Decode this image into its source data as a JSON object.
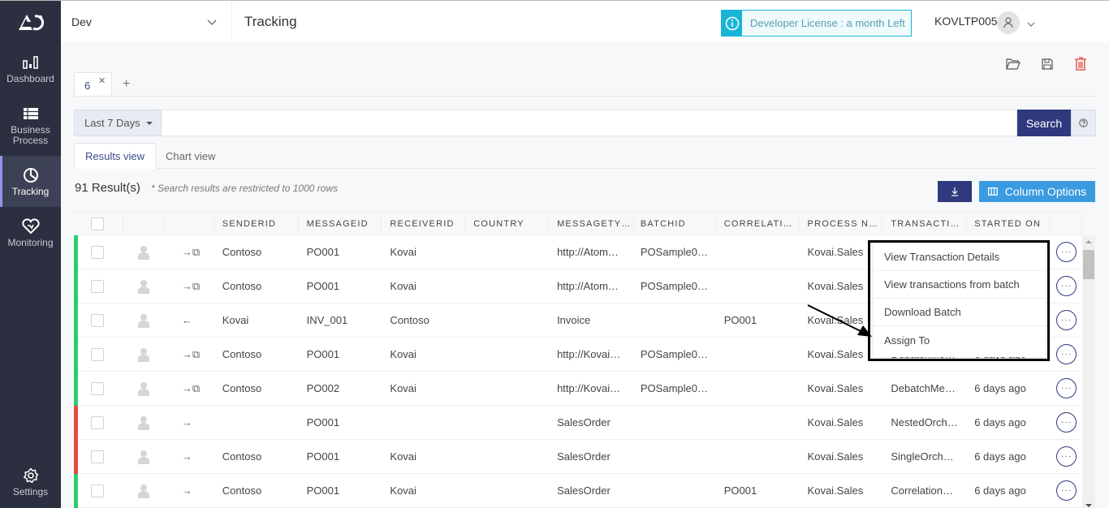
{
  "sidebar": {
    "logo": "logo-icon",
    "items": [
      {
        "label": "Dashboard",
        "icon": "bar-chart-icon"
      },
      {
        "label": "Business Process",
        "icon": "list-icon"
      },
      {
        "label": "Tracking",
        "icon": "pie-chart-icon",
        "active": true
      },
      {
        "label": "Monitoring",
        "icon": "heart-pulse-icon"
      }
    ],
    "settings": {
      "label": "Settings",
      "icon": "gear-icon"
    }
  },
  "header": {
    "environment": "Dev",
    "title": "Tracking",
    "license": "Developer License : a month Left",
    "username": "KOVLTP005"
  },
  "toolbar": {
    "icons": [
      "folder-open-icon",
      "save-icon",
      "trash-icon"
    ]
  },
  "query_tabs": [
    {
      "label": "6"
    }
  ],
  "query_tab_add": "+",
  "search": {
    "range_label": "Last 7 Days",
    "value": "",
    "placeholder": "",
    "button_label": "Search"
  },
  "view_tabs": [
    {
      "label": "Results view",
      "active": true
    },
    {
      "label": "Chart view",
      "active": false
    }
  ],
  "results": {
    "count_label": "91 Result(s)",
    "note": "* Search results are restricted to 1000 rows"
  },
  "actions": {
    "column_options_label": "Column Options"
  },
  "colors": {
    "success": "#2ecc71",
    "error": "#e74c3c",
    "primary": "#2e3a7d",
    "accent": "#3a9be0",
    "info": "#19b5d6",
    "danger": "#e05a4f"
  },
  "table": {
    "columns": [
      "SENDERID",
      "MESSAGEID",
      "RECEIVERID",
      "COUNTRY",
      "MESSAGETY…",
      "BATCHID",
      "CORRELATI…",
      "PROCESS N…",
      "TRANSACTI…",
      "STARTED ON"
    ],
    "rows": [
      {
        "status": "success",
        "direction": "→⧉",
        "senderid": "Contoso",
        "messageid": "PO001",
        "receiverid": "Kovai",
        "country": "",
        "messagetype": "http://Atom…",
        "batchid": "POSample0…",
        "correlation": "",
        "process": "Kovai.Sales",
        "transaction": "",
        "started": ""
      },
      {
        "status": "success",
        "direction": "→⧉",
        "senderid": "Contoso",
        "messageid": "PO001",
        "receiverid": "Kovai",
        "country": "",
        "messagetype": "http://Atom…",
        "batchid": "POSample0…",
        "correlation": "",
        "process": "Kovai.Sales",
        "transaction": "",
        "started": ""
      },
      {
        "status": "success",
        "direction": "←",
        "senderid": "Kovai",
        "messageid": "INV_001",
        "receiverid": "Contoso",
        "country": "",
        "messagetype": "Invoice",
        "batchid": "",
        "correlation": "PO001",
        "process": "Kovai.Sales",
        "transaction": "",
        "started": ""
      },
      {
        "status": "success",
        "direction": "→⧉",
        "senderid": "Contoso",
        "messageid": "PO001",
        "receiverid": "Kovai",
        "country": "",
        "messagetype": "http://Kovai…",
        "batchid": "POSample0…",
        "correlation": "",
        "process": "Kovai.Sales",
        "transaction": "DebatchMe…",
        "started": "6 days ago"
      },
      {
        "status": "success",
        "direction": "→⧉",
        "senderid": "Contoso",
        "messageid": "PO002",
        "receiverid": "Kovai",
        "country": "",
        "messagetype": "http://Kovai…",
        "batchid": "POSample0…",
        "correlation": "",
        "process": "Kovai.Sales",
        "transaction": "DebatchMe…",
        "started": "6 days ago"
      },
      {
        "status": "error",
        "direction": "→",
        "senderid": "",
        "messageid": "PO001",
        "receiverid": "",
        "country": "",
        "messagetype": "SalesOrder",
        "batchid": "",
        "correlation": "",
        "process": "Kovai.Sales",
        "transaction": "NestedOrch…",
        "started": "6 days ago"
      },
      {
        "status": "error",
        "direction": "→",
        "senderid": "Contoso",
        "messageid": "PO001",
        "receiverid": "Kovai",
        "country": "",
        "messagetype": "SalesOrder",
        "batchid": "",
        "correlation": "",
        "process": "Kovai.Sales",
        "transaction": "SingleOrch…",
        "started": "6 days ago"
      },
      {
        "status": "success",
        "direction": "→",
        "senderid": "Contoso",
        "messageid": "PO001",
        "receiverid": "Kovai",
        "country": "",
        "messagetype": "SalesOrder",
        "batchid": "",
        "correlation": "PO001",
        "process": "Kovai.Sales",
        "transaction": "Correlation…",
        "started": "6 days ago"
      }
    ]
  },
  "context_menu": {
    "items": [
      "View Transaction Details",
      "View transactions from batch",
      "Download Batch",
      "Assign To"
    ]
  }
}
